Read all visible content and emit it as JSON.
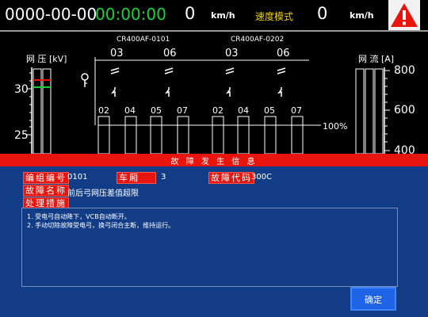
{
  "top": {
    "date": "0000-00-00",
    "time": "00:00:00",
    "speed_left": "0",
    "speed_left_unit": "km/h",
    "mode": "速度模式",
    "speed_right": "0",
    "speed_right_unit": "km/h"
  },
  "colors": {
    "time_green": "#19d23a",
    "mode_yellow": "#f1d400",
    "alarm_red": "#e8140e",
    "panel_blue": "#123d86",
    "button_blue": "#1f63e6"
  },
  "diagram": {
    "unit_a": "CR400AF-0101",
    "unit_b": "CR400AF-0202",
    "switches": [
      "03",
      "06",
      "03",
      "06"
    ],
    "cars": [
      "02",
      "04",
      "05",
      "07",
      "02",
      "04",
      "05",
      "07"
    ],
    "percent": "100%"
  },
  "voltage_gauge": {
    "label": "网 压 [kV]",
    "ticks": [
      "30",
      "25"
    ]
  },
  "current_gauge": {
    "label": "网 流 [A]",
    "ticks": [
      "800",
      "600",
      "400"
    ]
  },
  "fault": {
    "title": "故 障 发 生 信 息",
    "code_label": "编组编号",
    "code_value": "0101",
    "car_label": "车厢",
    "car_value": "3",
    "fault_code_label": "故障代码",
    "fault_code_value": "300C",
    "name_label": "故障名称",
    "name_value": "前后弓网压差值超限",
    "measures_label": "处理措施",
    "measures": [
      "1. 受电弓自动降下，VCB自动断开。",
      "2. 手动切除故障受电弓，换弓闭合主断，维持运行。"
    ],
    "ok_label": "确定"
  }
}
